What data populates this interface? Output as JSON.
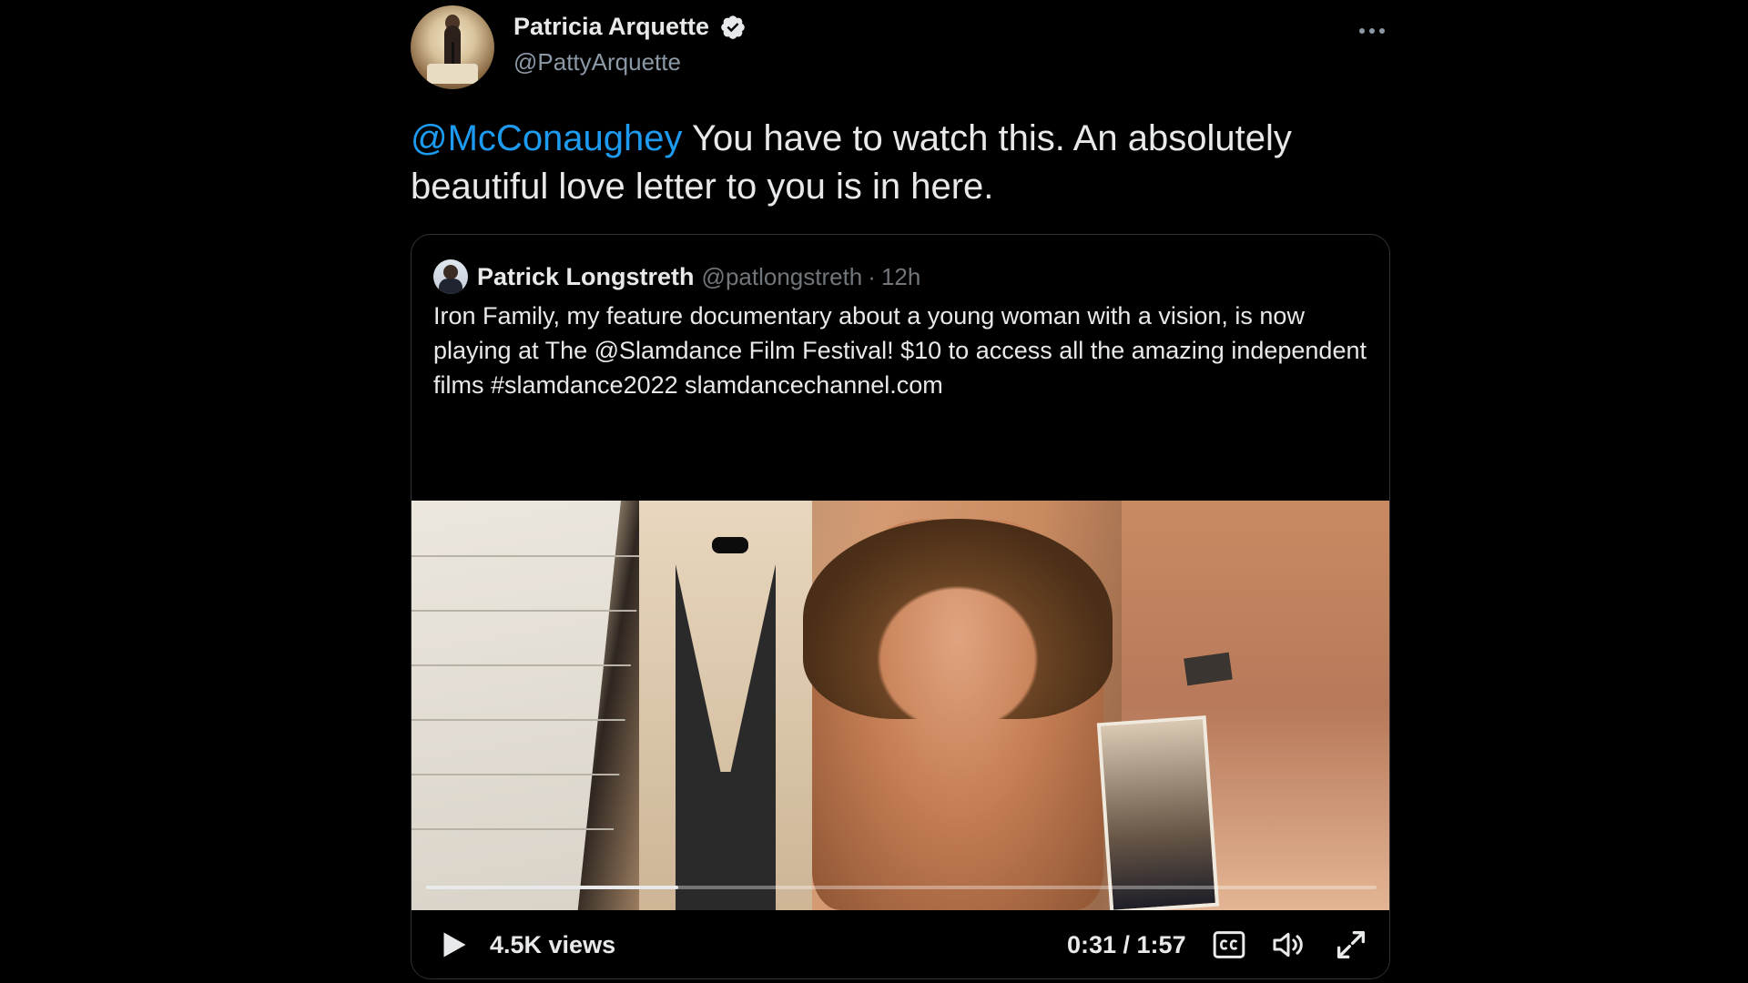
{
  "tweet": {
    "author": {
      "name": "Patricia Arquette",
      "handle": "@PattyArquette"
    },
    "text": {
      "mention": "@McConaughey",
      "body": " You have to watch this. An absolutely beautiful love letter to you is in here."
    }
  },
  "quote": {
    "author": {
      "name": "Patrick Longstreth",
      "handle": "@patlongstreth",
      "separator": "·",
      "time": "12h"
    },
    "text": "Iron Family, my feature documentary about a young woman with a vision, is now playing at The @Slamdance Film Festival! $10 to access all the amazing independent films #slamdance2022 slamdancechannel.com"
  },
  "video": {
    "views": "4.5K views",
    "time": "0:31 / 1:57",
    "progress": 0.265
  },
  "colors": {
    "accent": "#1d9bf0",
    "background": "#000000",
    "text": "#e7e9ea",
    "muted": "#71767b"
  },
  "icons": [
    "verified-icon",
    "more-icon",
    "play-icon",
    "cc-icon",
    "volume-icon",
    "fullscreen-icon"
  ]
}
